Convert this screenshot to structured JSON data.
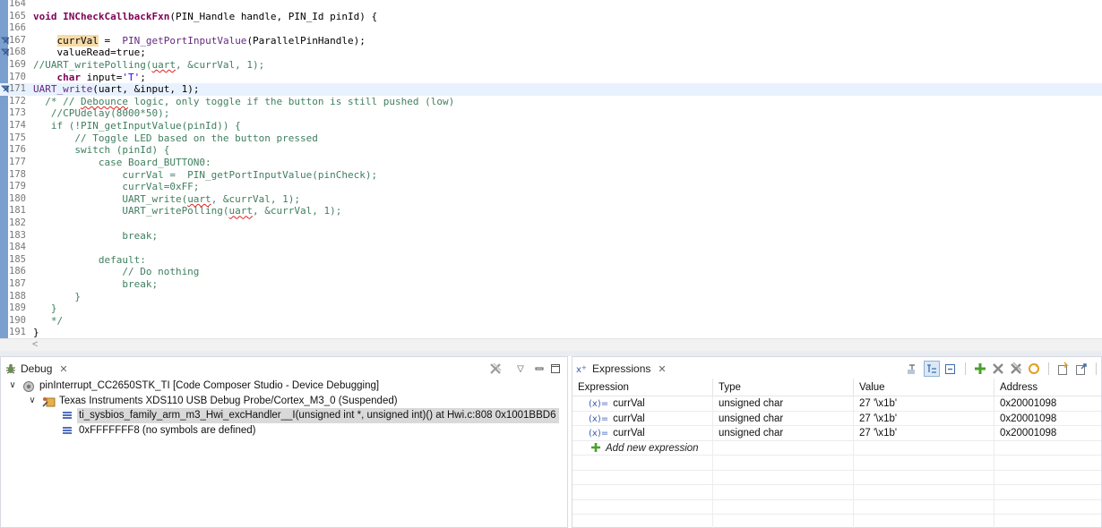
{
  "editor": {
    "lines": [
      {
        "n": "164",
        "segs": [
          {
            "t": ""
          }
        ]
      },
      {
        "n": "165",
        "segs": [
          {
            "t": "void ",
            "c": "kw"
          },
          {
            "t": "INCheckCallbackFxn",
            "c": "kwfn"
          },
          {
            "t": "(PIN_Handle handle, PIN_Id pinId) {"
          }
        ]
      },
      {
        "n": "166",
        "segs": [
          {
            "t": ""
          }
        ]
      },
      {
        "n": "167",
        "bp": true,
        "segs": [
          {
            "t": "    "
          },
          {
            "t": "currVal",
            "c": "hl"
          },
          {
            "t": " =  "
          },
          {
            "t": "PIN_getPortInputValue",
            "c": "fn"
          },
          {
            "t": "(ParallelPinHandle);"
          }
        ]
      },
      {
        "n": "168",
        "bp": true,
        "segs": [
          {
            "t": "    valueRead=true;"
          }
        ]
      },
      {
        "n": "169",
        "segs": [
          {
            "t": "//UART_writePolling(",
            "c": "cm"
          },
          {
            "t": "uart",
            "c": "cmsq"
          },
          {
            "t": ", &currVal, 1);",
            "c": "cm"
          }
        ]
      },
      {
        "n": "170",
        "segs": [
          {
            "t": "    "
          },
          {
            "t": "char",
            "c": "kw"
          },
          {
            "t": " input="
          },
          {
            "t": "'T'",
            "c": "str"
          },
          {
            "t": ";"
          }
        ]
      },
      {
        "n": "171",
        "bp": true,
        "current": true,
        "segs": [
          {
            "t": "UART_write",
            "c": "fn"
          },
          {
            "t": "(uart, &input, 1);"
          }
        ]
      },
      {
        "n": "172",
        "segs": [
          {
            "t": "  /* // ",
            "c": "cm"
          },
          {
            "t": "Debounce",
            "c": "cmsq"
          },
          {
            "t": " logic, only toggle if the button is still pushed (low)",
            "c": "cm"
          }
        ]
      },
      {
        "n": "173",
        "segs": [
          {
            "t": "   //CPUdelay(8000*50);",
            "c": "cm"
          }
        ]
      },
      {
        "n": "174",
        "segs": [
          {
            "t": "   if (!PIN_getInputValue(pinId)) {",
            "c": "cm"
          }
        ]
      },
      {
        "n": "175",
        "segs": [
          {
            "t": "       // Toggle LED based on the button pressed",
            "c": "cm"
          }
        ]
      },
      {
        "n": "176",
        "segs": [
          {
            "t": "       switch (pinId) {",
            "c": "cm"
          }
        ]
      },
      {
        "n": "177",
        "segs": [
          {
            "t": "           case Board_BUTTON0:",
            "c": "cm"
          }
        ]
      },
      {
        "n": "178",
        "segs": [
          {
            "t": "               currVal =  PIN_getPortInputValue(pinCheck);",
            "c": "cm"
          }
        ]
      },
      {
        "n": "179",
        "segs": [
          {
            "t": "               currVal=0xFF;",
            "c": "cm"
          }
        ]
      },
      {
        "n": "180",
        "segs": [
          {
            "t": "               UART_write(",
            "c": "cm"
          },
          {
            "t": "uart",
            "c": "cmsq"
          },
          {
            "t": ", &currVal, 1);",
            "c": "cm"
          }
        ]
      },
      {
        "n": "181",
        "segs": [
          {
            "t": "               UART_writePolling(",
            "c": "cm"
          },
          {
            "t": "uart",
            "c": "cmsq"
          },
          {
            "t": ", &currVal, 1);",
            "c": "cm"
          }
        ]
      },
      {
        "n": "182",
        "segs": [
          {
            "t": ""
          }
        ]
      },
      {
        "n": "183",
        "segs": [
          {
            "t": "               break;",
            "c": "cm"
          }
        ]
      },
      {
        "n": "184",
        "segs": [
          {
            "t": ""
          }
        ]
      },
      {
        "n": "185",
        "segs": [
          {
            "t": "           default:",
            "c": "cm"
          }
        ]
      },
      {
        "n": "186",
        "segs": [
          {
            "t": "               // Do nothing",
            "c": "cm"
          }
        ]
      },
      {
        "n": "187",
        "segs": [
          {
            "t": "               break;",
            "c": "cm"
          }
        ]
      },
      {
        "n": "188",
        "segs": [
          {
            "t": "       }",
            "c": "cm"
          }
        ]
      },
      {
        "n": "189",
        "segs": [
          {
            "t": "   }",
            "c": "cm"
          }
        ]
      },
      {
        "n": "190",
        "segs": [
          {
            "t": "   */",
            "c": "cm"
          }
        ]
      },
      {
        "n": "191",
        "segs": [
          {
            "t": "}"
          }
        ]
      }
    ],
    "scroll_arrow": "<"
  },
  "debug_view": {
    "tab_label": "Debug",
    "tree": [
      {
        "depth": 0,
        "twisty": "∨",
        "icon": "debug-session-icon",
        "label": "pinInterrupt_CC2650STK_TI [Code Composer Studio - Device Debugging]"
      },
      {
        "depth": 1,
        "twisty": "∨",
        "icon": "probe-cpu-icon",
        "label": "Texas Instruments XDS110 USB Debug Probe/Cortex_M3_0 (Suspended)"
      },
      {
        "depth": 2,
        "twisty": "",
        "icon": "stack-frame-icon",
        "label": "ti_sysbios_family_arm_m3_Hwi_excHandler__I(unsigned int *, unsigned int)() at Hwi.c:808 0x1001BBD6",
        "selected": true
      },
      {
        "depth": 2,
        "twisty": "",
        "icon": "stack-frame-icon",
        "label": "0xFFFFFFF8  (no symbols are defined)"
      }
    ]
  },
  "expressions_view": {
    "tab_label": "Expressions",
    "columns": [
      "Expression",
      "Type",
      "Value",
      "Address"
    ],
    "rows": [
      {
        "expression": "currVal",
        "type": "unsigned char",
        "value": "27 '\\x1b'",
        "address": "0x20001098"
      },
      {
        "expression": "currVal",
        "type": "unsigned char",
        "value": "27 '\\x1b'",
        "address": "0x20001098"
      },
      {
        "expression": "currVal",
        "type": "unsigned char",
        "value": "27 '\\x1b'",
        "address": "0x20001098"
      }
    ],
    "add_label": "Add new expression",
    "variable_icon_text": "(x)="
  },
  "colors": {
    "accent_gutter": "#7b9fce",
    "current_line": "#e8f2fe",
    "keyword": "#7f0055",
    "comment": "#3f7f5f"
  }
}
